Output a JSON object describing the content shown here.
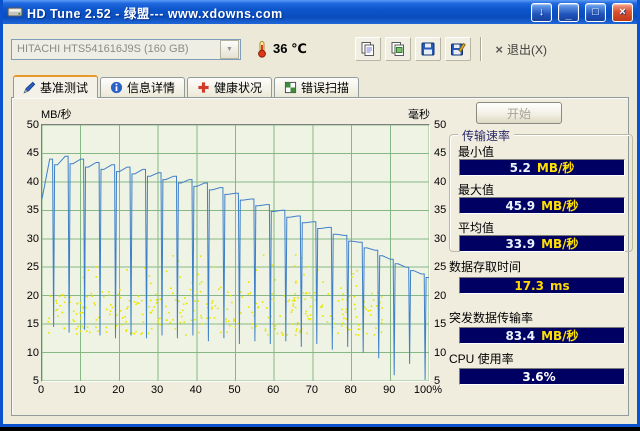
{
  "window": {
    "title": "HD Tune 2.52 - 绿盟--- www.xdowns.com"
  },
  "icons": {
    "download": "↓",
    "minimize": "_",
    "maximize": "□",
    "close": "×",
    "combo_arrow": "▼",
    "exit": "×"
  },
  "toolbar": {
    "drive_select": "HITACHI HTS541616J9S (160 GB)",
    "temperature": "36 ℃",
    "exit_label": "退出(X)"
  },
  "tabs": [
    {
      "label": "基准测试",
      "active": true
    },
    {
      "label": "信息详情",
      "active": false
    },
    {
      "label": "健康状况",
      "active": false
    },
    {
      "label": "错误扫描",
      "active": false
    }
  ],
  "benchmark": {
    "start_label": "开始",
    "group_title": "传输速率",
    "stats": [
      {
        "label": "最小值",
        "value": "5.2",
        "unit": "MB/秒",
        "value_color": "#EAF4FF",
        "unit_color": "#FFE000"
      },
      {
        "label": "最大值",
        "value": "45.9",
        "unit": "MB/秒",
        "value_color": "#EAF4FF",
        "unit_color": "#FFE000"
      },
      {
        "label": "平均值",
        "value": "33.9",
        "unit": "MB/秒",
        "value_color": "#EAF4FF",
        "unit_color": "#FFE000"
      }
    ],
    "extras": [
      {
        "label": "数据存取时间",
        "value": "17.3",
        "unit": "ms",
        "value_color": "#FFD800",
        "unit_color": "#FFD800"
      },
      {
        "label": "突发数据传输率",
        "value": "83.4",
        "unit": "MB/秒",
        "value_color": "#EAF4FF",
        "unit_color": "#FFE000"
      },
      {
        "label": "CPU 使用率",
        "value": "3.6%",
        "unit": "",
        "value_color": "#FFFFFF",
        "unit_color": "#FFFFFF"
      }
    ]
  },
  "chart_data": {
    "type": "line",
    "title": "",
    "left_axis_label": "MB/秒",
    "right_axis_label": "毫秒",
    "x_range": [
      0,
      100
    ],
    "y_range": [
      5,
      50
    ],
    "x_ticks": [
      "0",
      "10",
      "20",
      "30",
      "40",
      "50",
      "60",
      "70",
      "80",
      "90",
      "100%"
    ],
    "x_tick_values": [
      0,
      10,
      20,
      30,
      40,
      50,
      60,
      70,
      80,
      90,
      100
    ],
    "y_ticks": [
      "50",
      "45",
      "40",
      "35",
      "30",
      "25",
      "20",
      "15",
      "10",
      "5"
    ],
    "y_tick_values": [
      50,
      45,
      40,
      35,
      30,
      25,
      20,
      15,
      10,
      5
    ],
    "grid": true,
    "plot_bg": "#EFF3E4",
    "grid_color": "#86B886",
    "series": [
      {
        "name": "transfer-rate-MB-per-s",
        "color": "#4080C8",
        "x": [
          0,
          2,
          4,
          6,
          8,
          10,
          12,
          14,
          16,
          18,
          20,
          22,
          24,
          26,
          28,
          30,
          32,
          34,
          36,
          38,
          40,
          42,
          44,
          46,
          48,
          50,
          52,
          54,
          56,
          58,
          60,
          62,
          64,
          66,
          68,
          70,
          72,
          74,
          76,
          78,
          80,
          82,
          84,
          86,
          88,
          90,
          92,
          94,
          96,
          98,
          100
        ],
        "y": [
          37.0,
          44.0,
          43.0,
          44.5,
          43.2,
          44.0,
          42.6,
          43.4,
          42.2,
          43.0,
          41.8,
          42.6,
          41.4,
          42.2,
          41.0,
          41.6,
          40.4,
          41.0,
          39.8,
          40.4,
          39.2,
          39.8,
          38.6,
          39.0,
          37.8,
          38.0,
          36.8,
          37.0,
          35.8,
          36.0,
          34.8,
          35.0,
          33.8,
          34.0,
          32.8,
          33.0,
          31.8,
          32.0,
          30.8,
          30.6,
          29.6,
          29.4,
          28.4,
          28.0,
          27.0,
          26.4,
          25.6,
          25.0,
          24.4,
          23.8,
          23.2
        ]
      }
    ],
    "dips": [
      {
        "x": 3,
        "low": 14.5
      },
      {
        "x": 7,
        "low": 13.5
      },
      {
        "x": 11,
        "low": 14.0
      },
      {
        "x": 15,
        "low": 13.0
      },
      {
        "x": 19,
        "low": 12.5
      },
      {
        "x": 23,
        "low": 13.0
      },
      {
        "x": 27,
        "low": 12.5
      },
      {
        "x": 31,
        "low": 13.0
      },
      {
        "x": 35,
        "low": 12.5
      },
      {
        "x": 39,
        "low": 13.0
      },
      {
        "x": 43,
        "low": 12.0
      },
      {
        "x": 47,
        "low": 12.5
      },
      {
        "x": 51,
        "low": 11.5
      },
      {
        "x": 55,
        "low": 12.0
      },
      {
        "x": 59,
        "low": 11.5
      },
      {
        "x": 63,
        "low": 12.0
      },
      {
        "x": 67,
        "low": 11.0
      },
      {
        "x": 71,
        "low": 11.5
      },
      {
        "x": 75,
        "low": 10.5
      },
      {
        "x": 79,
        "low": 11.0
      },
      {
        "x": 83,
        "low": 10.0
      },
      {
        "x": 87,
        "low": 9.0
      },
      {
        "x": 91,
        "low": 6.0
      },
      {
        "x": 95,
        "low": 8.0
      },
      {
        "x": 99,
        "low": 5.2
      }
    ],
    "access_time_scatter": {
      "color": "#E8E400",
      "seed": 13,
      "clusters": [
        {
          "count": 300,
          "x_range": [
            1,
            88
          ],
          "y_range": [
            13.2,
            20.8
          ]
        },
        {
          "count": 45,
          "x_range": [
            4,
            86
          ],
          "y_range": [
            20.5,
            25.5
          ]
        },
        {
          "count": 8,
          "x_range": [
            30,
            70
          ],
          "y_range": [
            25.5,
            27.5
          ]
        }
      ]
    }
  }
}
